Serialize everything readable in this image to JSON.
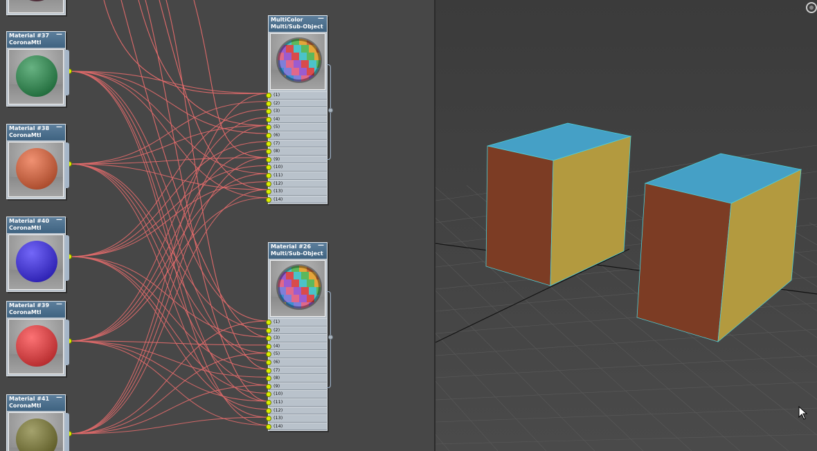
{
  "slate": {
    "material_nodes": [
      {
        "name": "Material #37",
        "type": "CoronaMtl",
        "color": "#3f8a5a"
      },
      {
        "name": "Material #38",
        "type": "CoronaMtl",
        "color": "#c8694a"
      },
      {
        "name": "Material #40",
        "type": "CoronaMtl",
        "color": "#4b3fd0"
      },
      {
        "name": "Material #39",
        "type": "CoronaMtl",
        "color": "#d44a4c"
      },
      {
        "name": "Material #41",
        "type": "CoronaMtl",
        "color": "#7c7a45"
      }
    ],
    "multi_nodes": [
      {
        "name": "MultiColor",
        "type": "Multi/Sub-Object",
        "slots": [
          "(1)",
          "(2)",
          "(3)",
          "(4)",
          "(5)",
          "(6)",
          "(7)",
          "(8)",
          "(9)",
          "(10)",
          "(11)",
          "(12)",
          "(13)",
          "(14)"
        ]
      },
      {
        "name": "Material #26",
        "type": "Multi/Sub-Object",
        "slots": [
          "(1)",
          "(2)",
          "(3)",
          "(4)",
          "(5)",
          "(6)",
          "(7)",
          "(8)",
          "(9)",
          "(10)",
          "(11)",
          "(12)",
          "(13)",
          "(14)"
        ]
      }
    ],
    "minimize_glyph": "—",
    "wire_color": "#e06a6a",
    "socket_color": "#dcf000"
  },
  "viewport": {
    "grid_color": "#5a5a5a",
    "axis_color": "#111111",
    "box_colors": {
      "top": "#45a0c6",
      "left": "#7c3c24",
      "right": "#b39a3f",
      "edge": "#4fd0d8"
    },
    "gizmo_icon": "viewcube-gizmo-icon",
    "cursor_icon": "mouse-pointer-icon"
  }
}
